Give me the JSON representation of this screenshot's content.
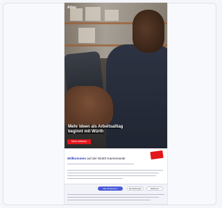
{
  "app": {
    "logo_text": "Aday"
  },
  "hero": {
    "headline": "Mehr Ideen als Arbeitsalltag",
    "subline": "beginnt mit Würth",
    "button_label": "Mehr erfahren"
  },
  "welcome": {
    "title_strong": "Willkommen",
    "title_rest": " auf der Würth Karriereseite"
  },
  "consent": {
    "accept_label": "Alle akzeptieren",
    "settings_label": "Einstellungen",
    "decline_label": "Ablehnen"
  },
  "colors": {
    "accent": "#e3161b",
    "button_blue": "#4a5bd8"
  }
}
